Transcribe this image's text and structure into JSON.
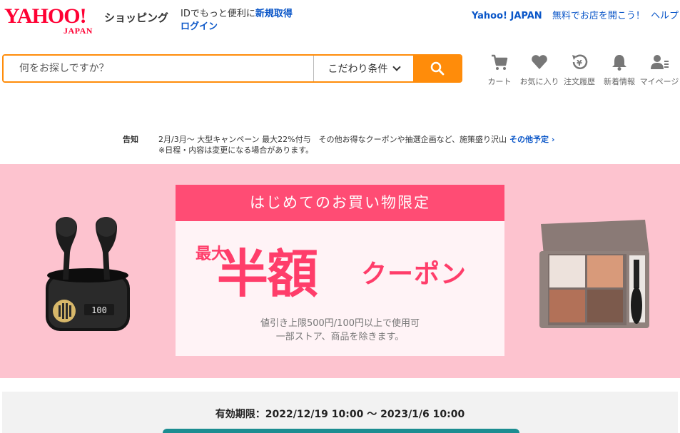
{
  "header": {
    "logo_main": "YAHOO!",
    "logo_sub": "JAPAN",
    "shop_title": "ショッピング",
    "id_text": "IDでもっと便利に",
    "signup_link": "新規取得",
    "login_link": "ログイン",
    "yahoo_japan_link": "Yahoo! JAPAN",
    "open_store_link": "無料でお店を開こう！",
    "help_link": "ヘルプ"
  },
  "search": {
    "placeholder": "何をお探しですか？",
    "condition_label": "こだわり条件"
  },
  "nav": [
    {
      "label": "カート",
      "icon": "cart-icon"
    },
    {
      "label": "お気に入り",
      "icon": "heart-icon"
    },
    {
      "label": "注文履歴",
      "icon": "history-icon"
    },
    {
      "label": "新着情報",
      "icon": "bell-icon"
    },
    {
      "label": "マイページ",
      "icon": "user-icon"
    }
  ],
  "notice": {
    "label": "告知",
    "line1": "2月/3月～ 大型キャンペーン 最大22%付与　その他お得なクーポンや抽選企画など、施策盛り沢山",
    "more_link": "その他予定",
    "line2": "※日程・内容は変更になる場合があります。"
  },
  "banner": {
    "headline": "はじめてのお買い物限定",
    "max_label": "最大",
    "half_label": "半額",
    "coupon_label": "クーポン",
    "note_line1": "値引き上限500円/100円以上で使用可",
    "note_line2": "一部ストア、商品を除きます。"
  },
  "validity": "有効期限：2022/12/19 10:00 ～ 2023/1/6 10:00",
  "colors": {
    "accent": "#ff8c0a",
    "brand_red": "#ff0033",
    "link": "#0a56c8",
    "banner_bg": "#fdc3cf",
    "banner_head": "#ff4c74",
    "cta": "#1c8d91"
  }
}
